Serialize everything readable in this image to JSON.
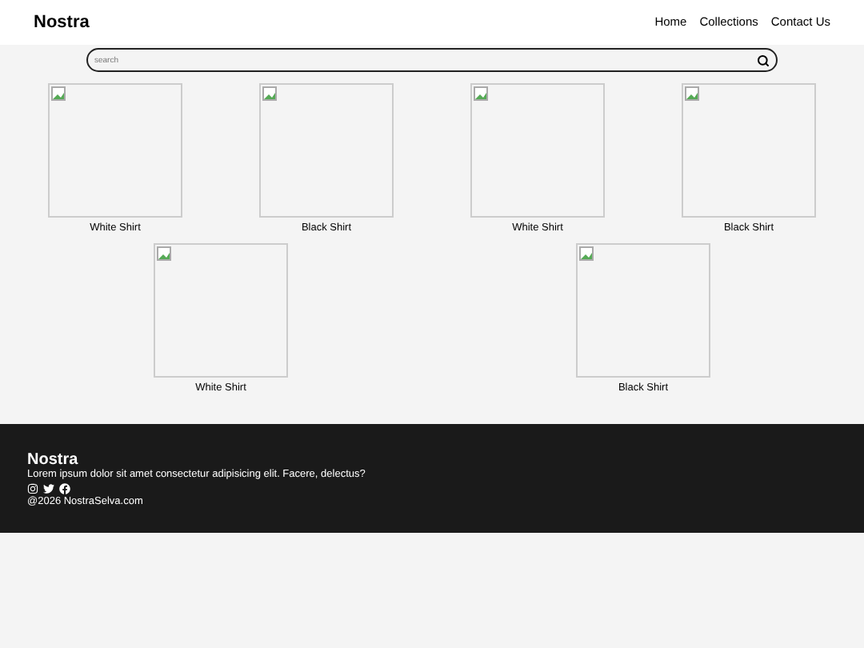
{
  "header": {
    "brand": "Nostra",
    "nav": [
      {
        "label": "Home"
      },
      {
        "label": "Collections"
      },
      {
        "label": "Contact Us"
      }
    ]
  },
  "search": {
    "placeholder": "search"
  },
  "product_rows": [
    [
      {
        "name": "White Shirt"
      },
      {
        "name": "Black Shirt"
      },
      {
        "name": "White Shirt"
      },
      {
        "name": "Black Shirt"
      }
    ],
    [
      {
        "name": "White Shirt"
      },
      {
        "name": "Black Shirt"
      }
    ]
  ],
  "footer": {
    "brand": "Nostra",
    "text": "Lorem ipsum dolor sit amet consectetur adipisicing elit. Facere, delectus?",
    "copyright": "@2026 NostraSelva.com"
  }
}
